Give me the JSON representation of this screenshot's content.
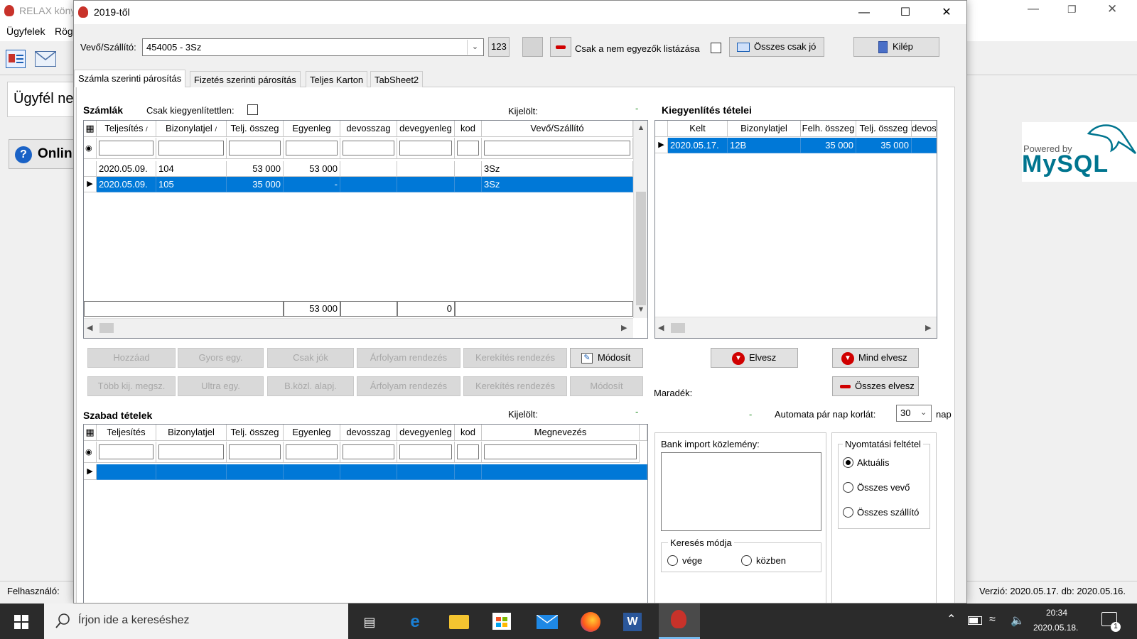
{
  "background_app": {
    "title": "RELAX köny",
    "menu": [
      "Ügyfelek",
      "Rög"
    ],
    "customer_label": "Ügyfél ne",
    "online_button": "Onlin",
    "user_label": "Felhasználó:",
    "version": "Verzió: 2020.05.17. db: 2020.05.16.",
    "mysql_logo": {
      "powered_by": "Powered by",
      "brand": "MySQL"
    }
  },
  "dialog": {
    "title": "2019-től",
    "controls": {
      "minimize": "—",
      "maximize": "☐",
      "close": "✕"
    },
    "toolbar": {
      "customer_label": "Vevő/Szállító:",
      "customer_value": "454005 - 3Sz",
      "code_button": "123",
      "mismatch_label": "Csak a nem egyezők listázása",
      "all_good_button": "Összes csak jó",
      "exit_button": "Kilép"
    },
    "tabs": [
      "Számla szerinti párosítás",
      "Fizetés szerinti párosítás",
      "Teljes Karton",
      "TabSheet2"
    ],
    "invoices": {
      "title": "Számlák",
      "only_unsettled_label": "Csak kiegyenlítettlen:",
      "selected_label": "Kijelölt:",
      "selected_value": "-",
      "columns": [
        "Teljesítés",
        "Bizonylatjel",
        "Telj. összeg",
        "Egyenleg",
        "devosszag",
        "devegyenleg",
        "kod",
        "Vevő/Szállító"
      ],
      "rows": [
        [
          "2020.05.09.",
          "104",
          "53 000",
          "53 000",
          "",
          "",
          "",
          "3Sz"
        ],
        [
          "2020.05.09.",
          "105",
          "35 000",
          "-",
          "",
          "",
          "",
          "3Sz"
        ]
      ],
      "footer": {
        "telj_osszeg": "53 000",
        "devegyenleg": "0"
      }
    },
    "settlements": {
      "title": "Kiegyenlítés tételei",
      "columns": [
        "Kelt",
        "Bizonylatjel",
        "Felh. összeg",
        "Telj. összeg",
        "devos:"
      ],
      "rows": [
        [
          "2020.05.17.",
          "12B",
          "35 000",
          "35 000",
          ""
        ]
      ]
    },
    "action_buttons_row1": [
      "Hozzáad",
      "Gyors egy.",
      "Csak jók",
      "Árfolyam rendezés",
      "Kerekítés rendezés",
      "Módosít"
    ],
    "action_buttons_row2": [
      "Több kij. megsz.",
      "Ultra egy.",
      "B.közl. alapj.",
      "Árfolyam rendezés",
      "Kerekítés rendezés",
      "Módosít"
    ],
    "settlement_buttons": {
      "remove": "Elvesz",
      "remove_all": "Mind elvesz",
      "remove_everything": "Összes elvesz"
    },
    "remainder_label": "Maradék:",
    "remainder_value": "-",
    "auto_pair": {
      "label": "Automata pár nap korlát:",
      "value": "30",
      "unit": "nap"
    },
    "free_items": {
      "title": "Szabad tételek",
      "selected_label": "Kijelölt:",
      "selected_value": "-",
      "columns": [
        "Teljesítés",
        "Bizonylatjel",
        "Telj. összeg",
        "Egyenleg",
        "devosszag",
        "devegyenleg",
        "kod",
        "Megnevezés"
      ]
    },
    "bank_import_label": "Bank import közlemény:",
    "search_mode": {
      "title": "Keresés módja",
      "options": [
        "vége",
        "közben"
      ]
    },
    "print_conditions": {
      "title": "Nyomtatási feltétel",
      "options": [
        "Aktuális",
        "Összes vevő",
        "Összes szállító"
      ],
      "selected": "Aktuális"
    }
  },
  "taskbar": {
    "search_placeholder": "Írjon ide a kereséshez",
    "time": "20:34",
    "date": "2020.05.18.",
    "notification_count": "1"
  },
  "colors": {
    "selection": "#0078d7",
    "taskbar": "#2b2b2b",
    "mysql_blue": "#00758f",
    "mysql_orange": "#f29111",
    "danger": "#d00000"
  }
}
